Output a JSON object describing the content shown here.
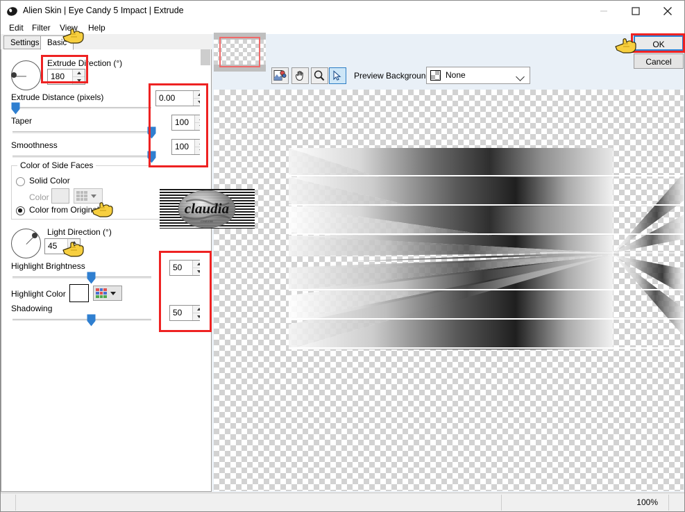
{
  "window": {
    "title": "Alien Skin | Eye Candy 5 Impact | Extrude",
    "app_icon": "alienskin-icon",
    "minimize": "minimize-icon",
    "maximize": "maximize-icon",
    "close": "close-icon"
  },
  "menu": [
    {
      "label": "Edit"
    },
    {
      "label": "Filter"
    },
    {
      "label": "View"
    },
    {
      "label": "Help"
    }
  ],
  "tabs": [
    {
      "label": "Settings",
      "selected": false
    },
    {
      "label": "Basic",
      "selected": true
    }
  ],
  "controls": {
    "extrude_direction": {
      "label": "Extrude Direction (°)",
      "value": "180",
      "angle_deg": 180
    },
    "extrude_distance": {
      "label": "Extrude Distance (pixels)",
      "value": "0.00",
      "slider_percent": 0
    },
    "taper": {
      "label": "Taper",
      "value": "100",
      "slider_percent": 100
    },
    "smoothness": {
      "label": "Smoothness",
      "value": "100",
      "slider_percent": 100
    },
    "side_faces_group": {
      "title": "Color of Side Faces",
      "solid_color_label": "Solid Color",
      "solid_color_selected": false,
      "color_label": "Color",
      "color_swatch": "#ebebeb",
      "from_original_label": "Color from Original",
      "from_original_selected": true
    },
    "light_direction": {
      "label": "Light Direction (°)",
      "value": "45",
      "angle_deg": 45
    },
    "highlight_brightness": {
      "label": "Highlight Brightness",
      "value": "50",
      "slider_percent": 50
    },
    "highlight_color": {
      "label": "Highlight Color",
      "swatch": "#ffffff"
    },
    "shadowing": {
      "label": "Shadowing",
      "value": "50",
      "slider_percent": 50
    }
  },
  "preview": {
    "navigator_thumb": "navigator-thumbnail",
    "tools": [
      {
        "name": "image-sampler-tool",
        "selected": false
      },
      {
        "name": "hand-pan-tool",
        "selected": false
      },
      {
        "name": "zoom-tool",
        "selected": false
      },
      {
        "name": "pointer-tool",
        "selected": true
      }
    ],
    "background_label": "Preview Background:",
    "background_value": "None"
  },
  "buttons": {
    "ok": "OK",
    "cancel": "Cancel"
  },
  "statusbar": {
    "zoom": "100%"
  },
  "watermark": {
    "text": "claudia"
  },
  "annotations": {
    "hand_cursors": 4,
    "red_boxes": 5
  },
  "colors": {
    "accent_blue": "#2a7fd4",
    "annotation_red": "#ee2222",
    "slider_thumb": "#2f7fd0",
    "hand_yellow": "#f5c518",
    "panel_bg": "#ffffff",
    "right_bg": "#e9f0f7"
  }
}
